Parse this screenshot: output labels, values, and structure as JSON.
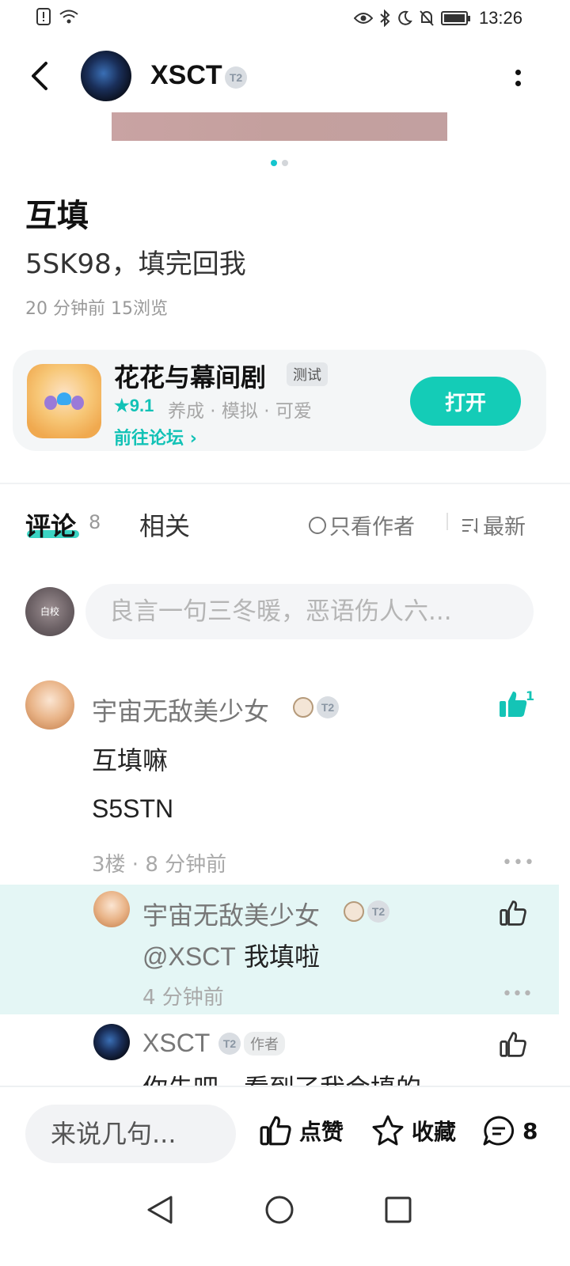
{
  "status_bar": {
    "time": "13:26"
  },
  "header": {
    "author_name": "XSCT",
    "level_badge": "T2"
  },
  "post": {
    "title": "互填",
    "body": "5SK98，填完回我",
    "meta": "20 分钟前  15浏览"
  },
  "game_card": {
    "name": "花花与幕间剧",
    "tag": "测试",
    "rating": "9.1",
    "categories": "养成 · 模拟 · 可爱",
    "forum_link": "前往论坛",
    "open_button": "打开"
  },
  "tabs": {
    "comments_label": "评论",
    "comments_count": "8",
    "related_label": "相关",
    "only_author": "只看作者",
    "sort": "最新"
  },
  "comment_input": {
    "placeholder": "良言一句三冬暖，恶语伤人六...",
    "avatar_text": "白校"
  },
  "comment": {
    "user": "宇宙无敌美少女",
    "like_count": "1",
    "line1": "互填嘛",
    "line2": "S5STN",
    "meta": "3楼 · 8 分钟前"
  },
  "replies": [
    {
      "user": "宇宙无敌美少女",
      "mention": "@XSCT",
      "text": "我填啦",
      "meta": "4 分钟前"
    },
    {
      "user": "XSCT",
      "author_tag": "作者",
      "text": "你先吧，看到了我会填的"
    }
  ],
  "bottom_bar": {
    "input_placeholder": "来说几句...",
    "like_label": "点赞",
    "favorite_label": "收藏",
    "comment_count": "8"
  },
  "colors": {
    "accent": "#14ccb7",
    "highlight": "#e4f6f5"
  }
}
